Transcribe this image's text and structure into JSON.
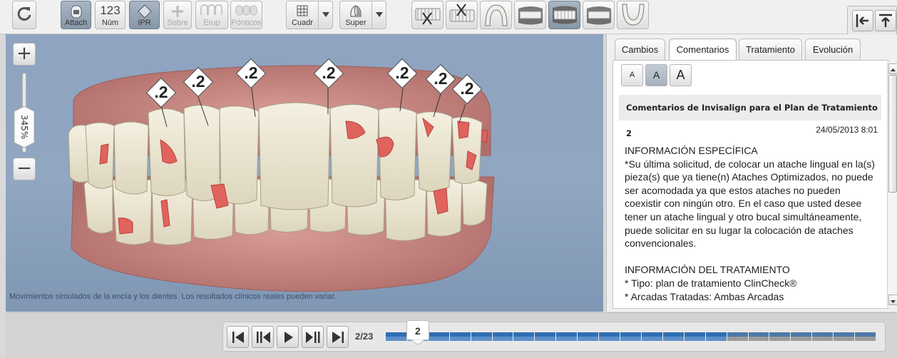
{
  "toolbar": {
    "tools": [
      {
        "label": "Attach",
        "active": true
      },
      {
        "label": "Núm",
        "icon_text": "123"
      },
      {
        "label": "IPR",
        "active": true
      },
      {
        "label": "Sobre",
        "disabled": true
      },
      {
        "label": "Erup",
        "disabled": true
      },
      {
        "label": "Pónticos",
        "disabled": true
      }
    ],
    "dropdowns": [
      {
        "label": "Cuadr"
      },
      {
        "label": "Super"
      }
    ],
    "views": [
      "upper-occlusal-remove-view",
      "lower-occlusal-remove-view",
      "upper-arch-view",
      "right-view",
      "front-view",
      "left-view",
      "lower-arch-view"
    ],
    "active_view": "front-view"
  },
  "viewer": {
    "zoom_label": "345%",
    "disclaimer": "Movimientos simulados de la encía y los dientes. Los resultados clínicos reales pueden variar.",
    "ipr_labels": [
      ".2",
      ".2",
      ".2",
      ".2",
      ".2",
      ".2",
      ".2"
    ]
  },
  "panel": {
    "tabs": [
      "Cambios",
      "Comentarios",
      "Tratamiento",
      "Evolución"
    ],
    "active_tab": "Comentarios",
    "font_sizes": [
      "A",
      "A",
      "A"
    ],
    "active_font": 1,
    "comment_title": "Comentarios de Invisalign para el Plan de Tratamiento 2",
    "comment_date": "24/05/2013 8:01",
    "paragraphs": [
      "INFORMACIÓN ESPECÍFICA\n*Su última solicitud, de colocar un atache lingual en la(s) pieza(s) que ya tiene(n) Ataches Optimizados, no puede ser acomodada ya que estos ataches no pueden coexistir con ningún otro. En el caso que usted desee tener un atache lingual y otro bucal simultáneamente, puede solicitar en su lugar la colocación de ataches convencionales.",
      "INFORMACIÓN DEL TRATAMIENTO\n* Tipo: plan de tratamiento ClinCheck®\n* Arcadas Tratadas: Ambas Arcadas"
    ]
  },
  "playback": {
    "stage_current": "2",
    "stage_count": "2/23",
    "total_stages": 23,
    "colors": {
      "upper": "#2f6eb4",
      "lower": "#5c8fc9",
      "upper_end": "#4d7aa8",
      "lower_end": "#9a9a9a"
    }
  }
}
